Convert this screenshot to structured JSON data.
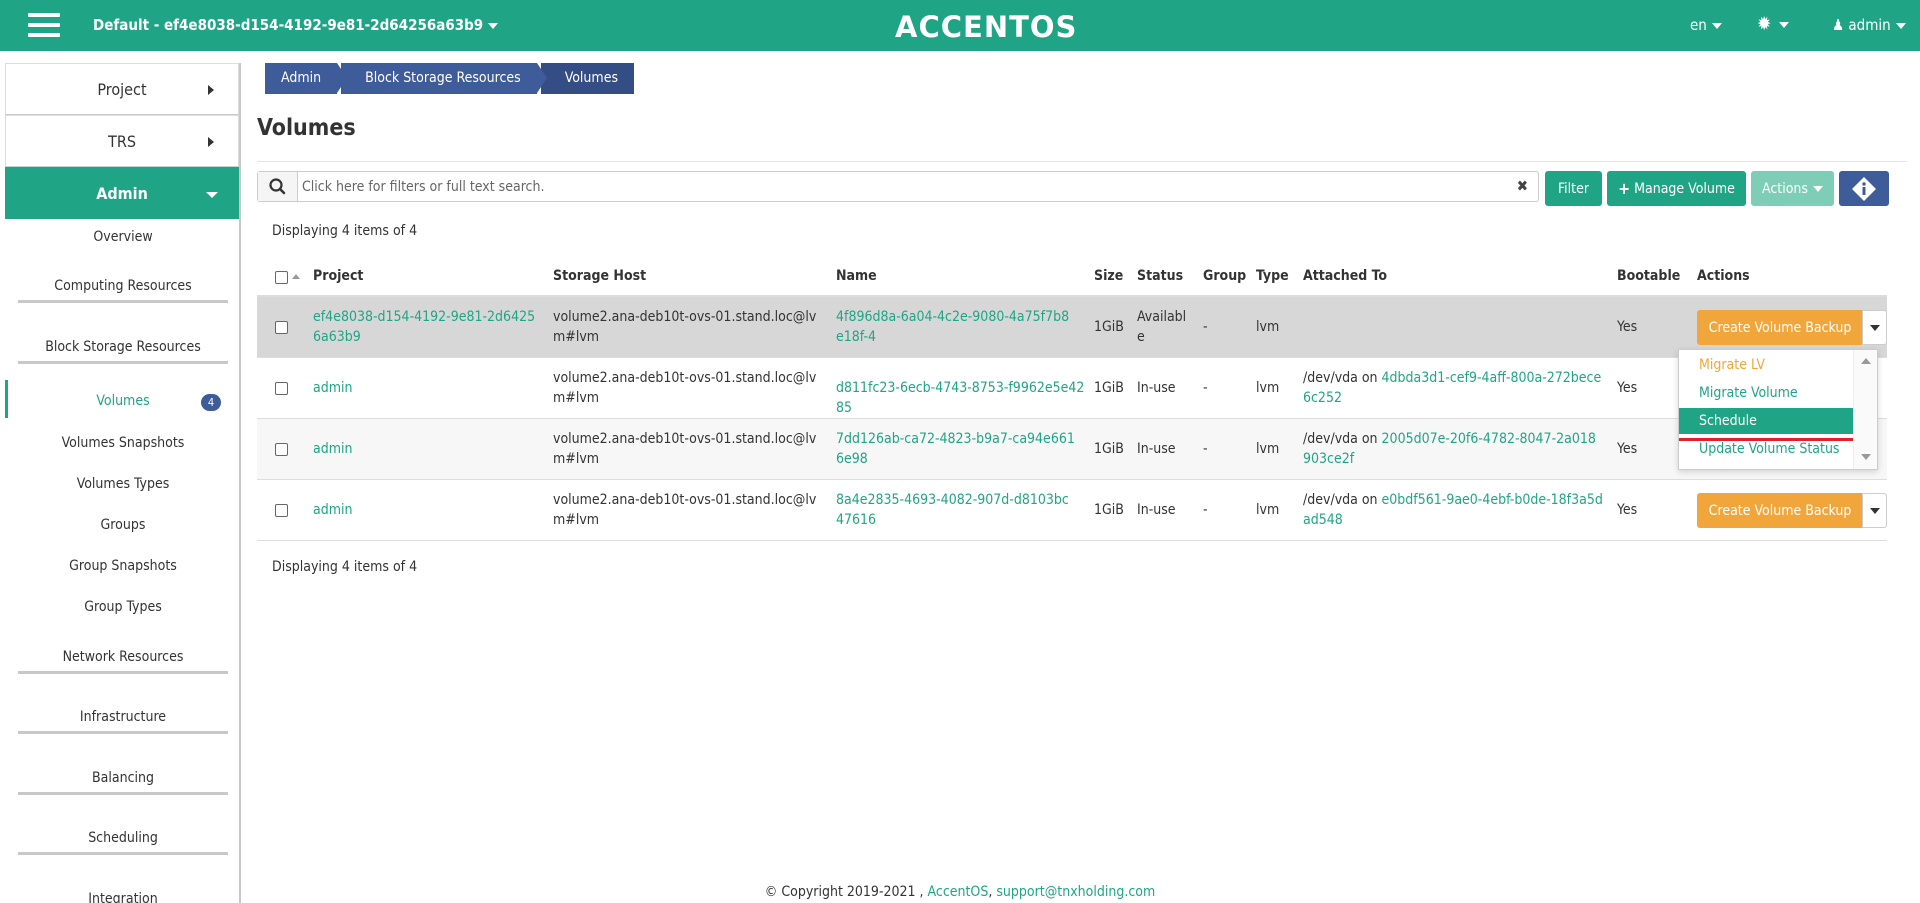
{
  "header": {
    "project_label": "Default - ef4e8038-d154-4192-9e81-2d64256a63b9",
    "logo": "ACCENTOS",
    "lang": "en",
    "gear_icon": "gear-icon",
    "user": "admin"
  },
  "sidebar": {
    "top": [
      {
        "label": "Project"
      },
      {
        "label": "TRS"
      },
      {
        "label": "Admin"
      }
    ],
    "items": [
      {
        "label": "Overview"
      },
      {
        "label": "Computing Resources"
      },
      {
        "label": "Block Storage Resources"
      },
      {
        "label": "Volumes",
        "badge": "4"
      },
      {
        "label": "Volumes Snapshots"
      },
      {
        "label": "Volumes Types"
      },
      {
        "label": "Groups"
      },
      {
        "label": "Group Snapshots"
      },
      {
        "label": "Group Types"
      },
      {
        "label": "Network Resources"
      },
      {
        "label": "Infrastructure"
      },
      {
        "label": "Balancing"
      },
      {
        "label": "Scheduling"
      },
      {
        "label": "Integration"
      }
    ]
  },
  "breadcrumb": [
    "Admin",
    "Block Storage Resources",
    "Volumes"
  ],
  "page_title": "Volumes",
  "search": {
    "placeholder": "Click here for filters or full text search."
  },
  "toolbar": {
    "filter": "Filter",
    "manage_volume": "Manage Volume",
    "actions": "Actions"
  },
  "displaying": "Displaying 4 items of 4",
  "table": {
    "columns": [
      "Project",
      "Storage Host",
      "Name",
      "Size",
      "Status",
      "Group",
      "Type",
      "Attached To",
      "Bootable",
      "Actions"
    ],
    "rows": [
      {
        "project": "ef4e8038-d154-4192-9e81-2d64256a63b9",
        "host": "volume2.ana-deb10t-ovs-01.stand.loc@lvm#lvm",
        "name": "4f896d8a-6a04-4c2e-9080-4a75f7b8e18f-4",
        "size": "1GiB",
        "status": "Available",
        "group": "-",
        "type": "lvm",
        "attached_prefix": "",
        "attached_id": "",
        "bootable": "Yes",
        "action": "Create Volume Backup"
      },
      {
        "project": "admin",
        "host": "volume2.ana-deb10t-ovs-01.stand.loc@lvm#lvm",
        "name": "d811fc23-6ecb-4743-8753-f9962e5e4285",
        "size": "1GiB",
        "status": "In-use",
        "group": "-",
        "type": "lvm",
        "attached_prefix": "/dev/vda on",
        "attached_id": "4dbda3d1-cef9-4aff-800a-272bece6c252",
        "bootable": "Yes",
        "action": ""
      },
      {
        "project": "admin",
        "host": "volume2.ana-deb10t-ovs-01.stand.loc@lvm#lvm",
        "name": "7dd126ab-ca72-4823-b9a7-ca94e6616e98",
        "size": "1GiB",
        "status": "In-use",
        "group": "-",
        "type": "lvm",
        "attached_prefix": "/dev/vda on",
        "attached_id": "2005d07e-20f6-4782-8047-2a018903ce2f",
        "bootable": "Yes",
        "action": ""
      },
      {
        "project": "admin",
        "host": "volume2.ana-deb10t-ovs-01.stand.loc@lvm#lvm",
        "name": "8a4e2835-4693-4082-907d-d8103bc47616",
        "size": "1GiB",
        "status": "In-use",
        "group": "-",
        "type": "lvm",
        "attached_prefix": "/dev/vda on",
        "attached_id": "e0bdf561-9ae0-4ebf-b0de-18f3a5dad548",
        "bootable": "Yes",
        "action": "Create Volume Backup"
      }
    ]
  },
  "dropdown": [
    "Migrate LV",
    "Migrate Volume",
    "Schedule",
    "Update Volume Status"
  ],
  "footer": {
    "copyright": "© Copyright 2019-2021 ,",
    "brand": "AccentOS",
    "sep": ",",
    "email": "support@tnxholding.com"
  },
  "colors": {
    "primary": "#1fa585",
    "navy": "#3e5b9a",
    "warning": "#f0a63a"
  }
}
